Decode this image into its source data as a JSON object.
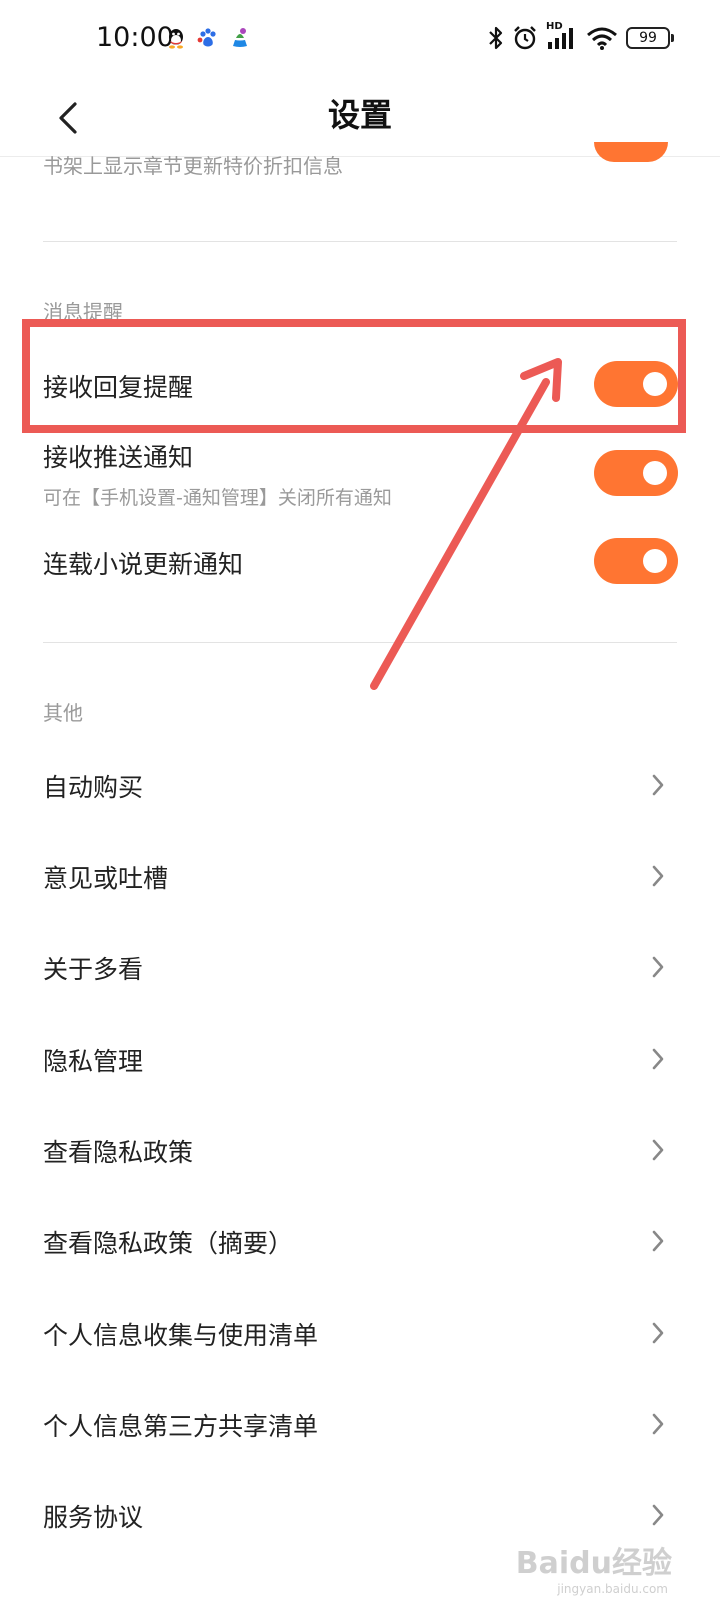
{
  "status_bar": {
    "time": "10:00",
    "app_icons": [
      "qq-icon",
      "baidu-paw-icon",
      "china-mobile-icon"
    ],
    "indicators": [
      "bluetooth-icon",
      "alarm-icon",
      "signal-hd-icon",
      "wifi-icon"
    ],
    "signal_tag": "HD",
    "battery": "99"
  },
  "header": {
    "title": "设置"
  },
  "cut_row": {
    "label": "书架上显示章节更新特价折扣信息",
    "enabled": true
  },
  "sections": {
    "messages": {
      "title": "消息提醒",
      "items": [
        {
          "label": "接收回复提醒",
          "enabled": true
        },
        {
          "label": "接收推送通知",
          "sub": "可在【手机设置-通知管理】关闭所有通知",
          "enabled": true
        },
        {
          "label": "连载小说更新通知",
          "enabled": true
        }
      ]
    },
    "other": {
      "title": "其他",
      "items": [
        {
          "label": "自动购买"
        },
        {
          "label": "意见或吐槽"
        },
        {
          "label": "关于多看"
        },
        {
          "label": "隐私管理"
        },
        {
          "label": "查看隐私政策"
        },
        {
          "label": "查看隐私政策（摘要）"
        },
        {
          "label": "个人信息收集与使用清单"
        },
        {
          "label": "个人信息第三方共享清单"
        },
        {
          "label": "服务协议"
        }
      ]
    }
  },
  "colors": {
    "accent": "#ff7532",
    "annotation": "#ec5a55"
  },
  "watermark": {
    "brand": "Baidu经验",
    "url": "jingyan.baidu.com"
  }
}
